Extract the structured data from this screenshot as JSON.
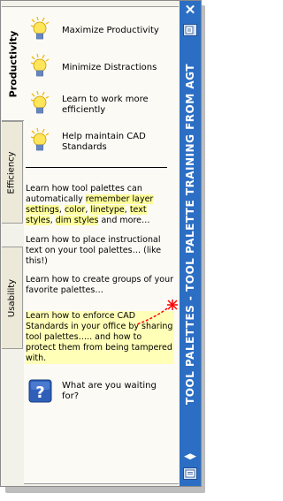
{
  "tabs": [
    {
      "label": "Productivity",
      "active": true
    },
    {
      "label": "Efficiency",
      "active": false
    },
    {
      "label": "Usability",
      "active": false
    }
  ],
  "tools": [
    {
      "label": "Maximize Productivity",
      "icon": "lightbulb-icon"
    },
    {
      "label": "Minimize Distractions",
      "icon": "lightbulb-icon"
    },
    {
      "label": "Learn to work more efficiently",
      "icon": "lightbulb-icon"
    },
    {
      "label": "Help maintain CAD Standards",
      "icon": "lightbulb-icon"
    }
  ],
  "notes": {
    "note1": {
      "prefix": "Learn how tool palettes can automatically ",
      "hl1": "remember layer settings",
      "sep1": ", ",
      "hl2": "color",
      "sep2": ", ",
      "hl3": "linetype",
      "sep3": ", ",
      "hl4": "text styles",
      "sep4": ", ",
      "hl5": "dim styles",
      "suffix": " and more…"
    },
    "note2": "Learn how to place instructional text on your tool palettes…  (like this!)",
    "note3": "Learn how to create groups of your favorite palettes…",
    "note4": "Learn how to enforce CAD Standards in your office by sharing tool palettes….. and how to protect them from being tampered with."
  },
  "help_tool": {
    "label": "What are you waiting for?",
    "icon": "question-help-icon"
  },
  "title_bar": {
    "title": "TOOL PALETTES - TOOL PALETTE TRAINING FROM AGT",
    "close_icon": "close-icon",
    "color": "#2b6ec4"
  },
  "colors": {
    "highlight": "#ffff9c",
    "annotation": "#ff0000"
  }
}
